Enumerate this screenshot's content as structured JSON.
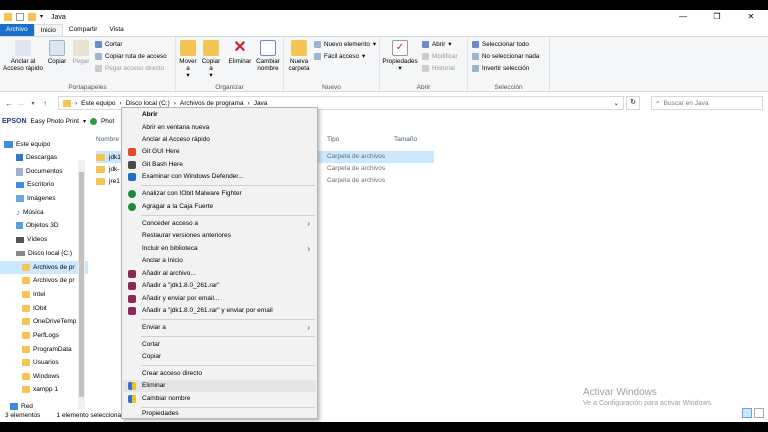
{
  "window": {
    "title": "Java",
    "controls": [
      "—",
      "❐",
      "✕"
    ]
  },
  "tabs": [
    "Archivo",
    "Inicio",
    "Compartir",
    "Vista"
  ],
  "ribbon": {
    "portapapeles": {
      "label": "Portapapeles",
      "pin": "Anclar al Acceso rápido",
      "copy": "Copiar",
      "paste": "Pegar",
      "cut": "Cortar",
      "copy_path": "Copiar ruta de acceso",
      "paste_shortcut": "Pegar acceso directo"
    },
    "organizar": {
      "label": "Organizar",
      "move_to": "Mover a",
      "copy_to": "Copiar a",
      "delete": "Eliminar",
      "rename": "Cambiar nombre"
    },
    "nuevo": {
      "label": "Nuevo",
      "new_folder": "Nueva carpeta",
      "new_item": "Nuevo elemento",
      "easy_access": "Fácil acceso"
    },
    "abrir": {
      "label": "Abrir",
      "properties": "Propiedades",
      "open": "Abrir",
      "edit": "Modificar",
      "history": "Historial"
    },
    "seleccion": {
      "label": "Selección",
      "select_all": "Seleccionar todo",
      "select_none": "No seleccionar nada",
      "invert": "Invertir selección"
    }
  },
  "address": {
    "crumbs": [
      "Este equipo",
      "Disco local (C:)",
      "Archivos de programa",
      "Java"
    ],
    "search_placeholder": "Buscar en Java"
  },
  "epson_bar": {
    "brand": "EPSON",
    "app": "Easy Photo Print",
    "photo": "Phot"
  },
  "nav": {
    "items": [
      "Este equipo",
      "Descargas",
      "Documentos",
      "Escritorio",
      "Imágenes",
      "Música",
      "Objetos 3D",
      "Vídeos",
      "Disco local (C:)",
      "Archivos de pr",
      "Archivos de pr",
      "Intel",
      "IObit",
      "OneDriveTemp",
      "PerfLogs",
      "ProgramData",
      "Usuarios",
      "Windows",
      "xampp 1",
      "Red"
    ]
  },
  "columns": {
    "name": "Nombre",
    "type": "Tipo",
    "size": "Tamaño"
  },
  "files": [
    {
      "name": "jdk1",
      "type": "Carpeta de archivos"
    },
    {
      "name": "jdk-",
      "type": "Carpeta de archivos"
    },
    {
      "name": "jre1",
      "type": "Carpeta de archivos"
    }
  ],
  "context_menu": {
    "items": [
      "Abrir",
      "Abrir en ventana nueva",
      "Anclar al Acceso rápido",
      "Git GUI Here",
      "Git Bash Here",
      "Examinar con Windows Defender...",
      "Analizar con IObit Malware Fighter",
      "Agragar a la Caja Fuerte",
      "Conceder acceso a",
      "Restaurar versiones anteriores",
      "Incluir en biblioteca",
      "Anclar a Inicio",
      "Añadir al archivo...",
      "Añadir a \"jdk1.8.0_261.rar\"",
      "Añadir y enviar por email...",
      "Añadir a \"jdk1.8.0_261.rar\" y enviar por email",
      "Enviar a",
      "Cortar",
      "Copiar",
      "Crear acceso directo",
      "Eliminar",
      "Cambiar nombre",
      "Propiedades"
    ]
  },
  "status": {
    "count": "3 elementos",
    "selected": "1 elemento seleccionado"
  },
  "activate": {
    "title": "Activar Windows",
    "subtitle": "Ve a Configuración para activar Windows."
  }
}
